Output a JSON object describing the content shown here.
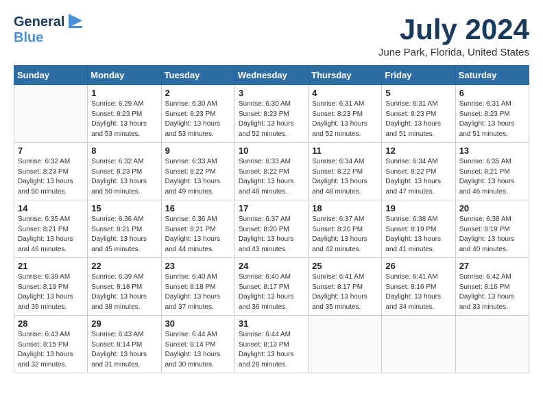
{
  "header": {
    "logo": {
      "line1": "General",
      "line2": "Blue"
    },
    "month_year": "July 2024",
    "location": "June Park, Florida, United States"
  },
  "weekdays": [
    "Sunday",
    "Monday",
    "Tuesday",
    "Wednesday",
    "Thursday",
    "Friday",
    "Saturday"
  ],
  "weeks": [
    [
      {
        "day": "",
        "info": ""
      },
      {
        "day": "1",
        "info": "Sunrise: 6:29 AM\nSunset: 8:23 PM\nDaylight: 13 hours\nand 53 minutes."
      },
      {
        "day": "2",
        "info": "Sunrise: 6:30 AM\nSunset: 8:23 PM\nDaylight: 13 hours\nand 53 minutes."
      },
      {
        "day": "3",
        "info": "Sunrise: 6:30 AM\nSunset: 8:23 PM\nDaylight: 13 hours\nand 52 minutes."
      },
      {
        "day": "4",
        "info": "Sunrise: 6:31 AM\nSunset: 8:23 PM\nDaylight: 13 hours\nand 52 minutes."
      },
      {
        "day": "5",
        "info": "Sunrise: 6:31 AM\nSunset: 8:23 PM\nDaylight: 13 hours\nand 51 minutes."
      },
      {
        "day": "6",
        "info": "Sunrise: 6:31 AM\nSunset: 8:23 PM\nDaylight: 13 hours\nand 51 minutes."
      }
    ],
    [
      {
        "day": "7",
        "info": "Sunrise: 6:32 AM\nSunset: 8:23 PM\nDaylight: 13 hours\nand 50 minutes."
      },
      {
        "day": "8",
        "info": "Sunrise: 6:32 AM\nSunset: 8:23 PM\nDaylight: 13 hours\nand 50 minutes."
      },
      {
        "day": "9",
        "info": "Sunrise: 6:33 AM\nSunset: 8:22 PM\nDaylight: 13 hours\nand 49 minutes."
      },
      {
        "day": "10",
        "info": "Sunrise: 6:33 AM\nSunset: 8:22 PM\nDaylight: 13 hours\nand 48 minutes."
      },
      {
        "day": "11",
        "info": "Sunrise: 6:34 AM\nSunset: 8:22 PM\nDaylight: 13 hours\nand 48 minutes."
      },
      {
        "day": "12",
        "info": "Sunrise: 6:34 AM\nSunset: 8:22 PM\nDaylight: 13 hours\nand 47 minutes."
      },
      {
        "day": "13",
        "info": "Sunrise: 6:35 AM\nSunset: 8:21 PM\nDaylight: 13 hours\nand 46 minutes."
      }
    ],
    [
      {
        "day": "14",
        "info": "Sunrise: 6:35 AM\nSunset: 8:21 PM\nDaylight: 13 hours\nand 46 minutes."
      },
      {
        "day": "15",
        "info": "Sunrise: 6:36 AM\nSunset: 8:21 PM\nDaylight: 13 hours\nand 45 minutes."
      },
      {
        "day": "16",
        "info": "Sunrise: 6:36 AM\nSunset: 8:21 PM\nDaylight: 13 hours\nand 44 minutes."
      },
      {
        "day": "17",
        "info": "Sunrise: 6:37 AM\nSunset: 8:20 PM\nDaylight: 13 hours\nand 43 minutes."
      },
      {
        "day": "18",
        "info": "Sunrise: 6:37 AM\nSunset: 8:20 PM\nDaylight: 13 hours\nand 42 minutes."
      },
      {
        "day": "19",
        "info": "Sunrise: 6:38 AM\nSunset: 8:19 PM\nDaylight: 13 hours\nand 41 minutes."
      },
      {
        "day": "20",
        "info": "Sunrise: 6:38 AM\nSunset: 8:19 PM\nDaylight: 13 hours\nand 40 minutes."
      }
    ],
    [
      {
        "day": "21",
        "info": "Sunrise: 6:39 AM\nSunset: 8:19 PM\nDaylight: 13 hours\nand 39 minutes."
      },
      {
        "day": "22",
        "info": "Sunrise: 6:39 AM\nSunset: 8:18 PM\nDaylight: 13 hours\nand 38 minutes."
      },
      {
        "day": "23",
        "info": "Sunrise: 6:40 AM\nSunset: 8:18 PM\nDaylight: 13 hours\nand 37 minutes."
      },
      {
        "day": "24",
        "info": "Sunrise: 6:40 AM\nSunset: 8:17 PM\nDaylight: 13 hours\nand 36 minutes."
      },
      {
        "day": "25",
        "info": "Sunrise: 6:41 AM\nSunset: 8:17 PM\nDaylight: 13 hours\nand 35 minutes."
      },
      {
        "day": "26",
        "info": "Sunrise: 6:41 AM\nSunset: 8:16 PM\nDaylight: 13 hours\nand 34 minutes."
      },
      {
        "day": "27",
        "info": "Sunrise: 6:42 AM\nSunset: 8:16 PM\nDaylight: 13 hours\nand 33 minutes."
      }
    ],
    [
      {
        "day": "28",
        "info": "Sunrise: 6:43 AM\nSunset: 8:15 PM\nDaylight: 13 hours\nand 32 minutes."
      },
      {
        "day": "29",
        "info": "Sunrise: 6:43 AM\nSunset: 8:14 PM\nDaylight: 13 hours\nand 31 minutes."
      },
      {
        "day": "30",
        "info": "Sunrise: 6:44 AM\nSunset: 8:14 PM\nDaylight: 13 hours\nand 30 minutes."
      },
      {
        "day": "31",
        "info": "Sunrise: 6:44 AM\nSunset: 8:13 PM\nDaylight: 13 hours\nand 28 minutes."
      },
      {
        "day": "",
        "info": ""
      },
      {
        "day": "",
        "info": ""
      },
      {
        "day": "",
        "info": ""
      }
    ]
  ]
}
